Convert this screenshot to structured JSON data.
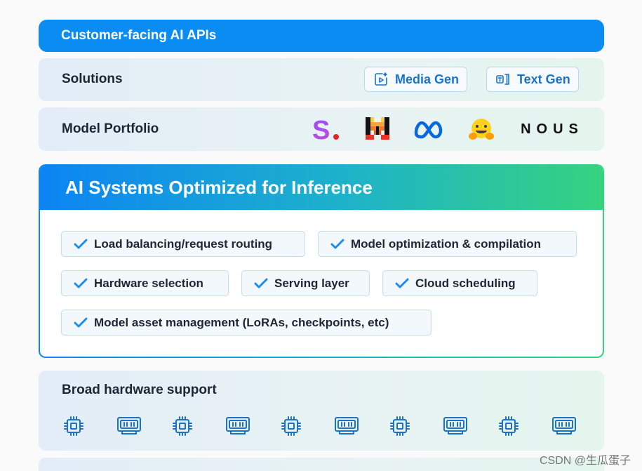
{
  "api_bar": {
    "title": "Customer-facing AI APIs"
  },
  "solutions": {
    "label": "Solutions",
    "buttons": [
      {
        "label": "Media Gen",
        "icon": "media-gen-icon"
      },
      {
        "label": "Text Gen",
        "icon": "text-gen-icon"
      }
    ]
  },
  "model_portfolio": {
    "label": "Model Portfolio",
    "logos": [
      {
        "name": "stability-logo",
        "text": "S."
      },
      {
        "name": "mistral-logo"
      },
      {
        "name": "meta-logo"
      },
      {
        "name": "hugging-face-logo"
      },
      {
        "name": "nous-logo",
        "text": "NOUS"
      }
    ]
  },
  "ai_systems": {
    "title": "AI Systems Optimized for Inference",
    "features": [
      "Load balancing/request routing",
      "Model optimization & compilation",
      "Hardware selection",
      "Serving layer",
      "Cloud scheduling",
      "Model asset management (LoRAs, checkpoints, etc)"
    ]
  },
  "hardware": {
    "label": "Broad hardware support",
    "icons": [
      "cpu-chip-icon",
      "gpu-card-icon",
      "cpu-chip-icon",
      "gpu-card-icon",
      "cpu-chip-icon",
      "gpu-card-icon",
      "cpu-chip-icon",
      "gpu-card-icon",
      "cpu-chip-icon",
      "gpu-card-icon"
    ]
  },
  "watermark": "CSDN @生瓜蛋子",
  "colors": {
    "api_blue": "#0a8cf2",
    "accent_blue": "#1b73c9",
    "gradient_start": "#0c84f4",
    "gradient_end": "#35d37f"
  }
}
